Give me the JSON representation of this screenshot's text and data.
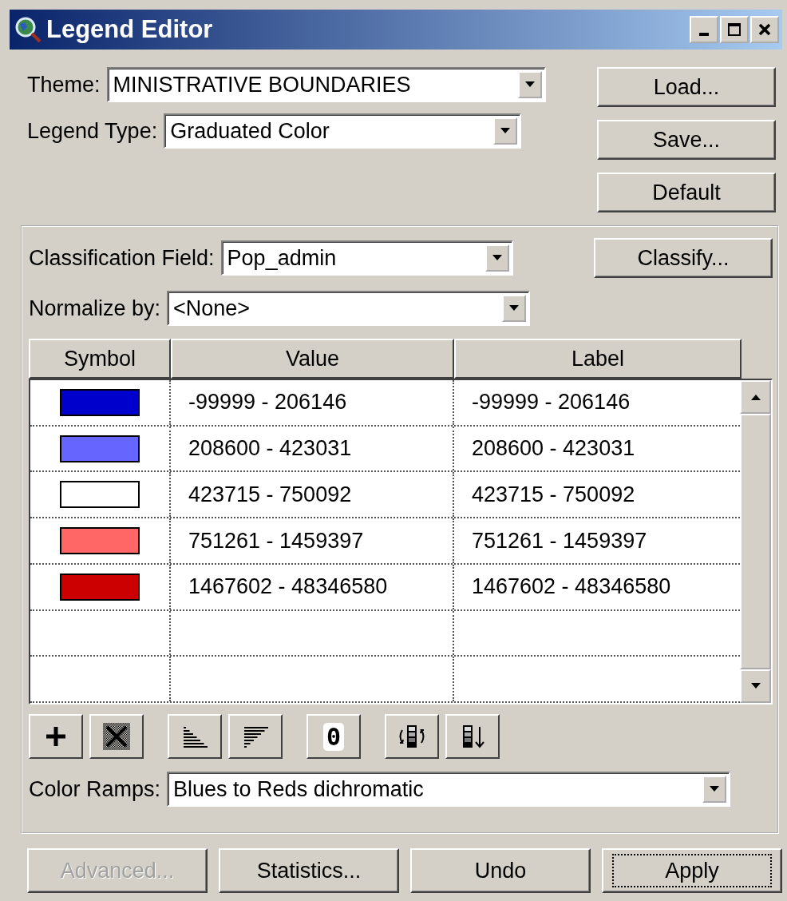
{
  "window": {
    "title": "Legend Editor"
  },
  "theme": {
    "label": "Theme:",
    "value": "MINISTRATIVE BOUNDARIES"
  },
  "legend_type": {
    "label": "Legend Type:",
    "value": "Graduated Color"
  },
  "side_buttons": [
    "Load...",
    "Save...",
    "Default"
  ],
  "classification_field": {
    "label": "Classification Field:",
    "value": "Pop_admin"
  },
  "classify_button": "Classify...",
  "normalize_by": {
    "label": "Normalize by:",
    "value": "<None>"
  },
  "table": {
    "columns": [
      "Symbol",
      "Value",
      "Label"
    ],
    "rows": [
      {
        "color": "#0000cc",
        "value": "-99999 - 206146",
        "label": "-99999 - 206146"
      },
      {
        "color": "#6666ff",
        "value": "208600 - 423031",
        "label": "208600 - 423031"
      },
      {
        "color": "#ffffff",
        "value": "423715 - 750092",
        "label": "423715 - 750092"
      },
      {
        "color": "#ff6666",
        "value": "751261 - 1459397",
        "label": "751261 - 1459397"
      },
      {
        "color": "#cc0000",
        "value": "1467602 - 48346580",
        "label": "1467602 - 48346580"
      }
    ]
  },
  "toolbar": [
    [
      {
        "kind": "add"
      },
      {
        "kind": "delete"
      }
    ],
    [
      {
        "kind": "sort-asc"
      },
      {
        "kind": "sort-desc"
      }
    ],
    [
      {
        "kind": "zero",
        "text": "0"
      }
    ],
    [
      {
        "kind": "flip"
      },
      {
        "kind": "reverse"
      }
    ]
  ],
  "color_ramps": {
    "label": "Color Ramps:",
    "value": "Blues to Reds dichromatic"
  },
  "bottom_buttons": [
    {
      "label": "Advanced...",
      "disabled": true,
      "focused": false
    },
    {
      "label": "Statistics...",
      "disabled": false,
      "focused": false
    },
    {
      "label": "Undo",
      "disabled": false,
      "focused": false
    },
    {
      "label": "Apply",
      "disabled": false,
      "focused": true
    }
  ]
}
